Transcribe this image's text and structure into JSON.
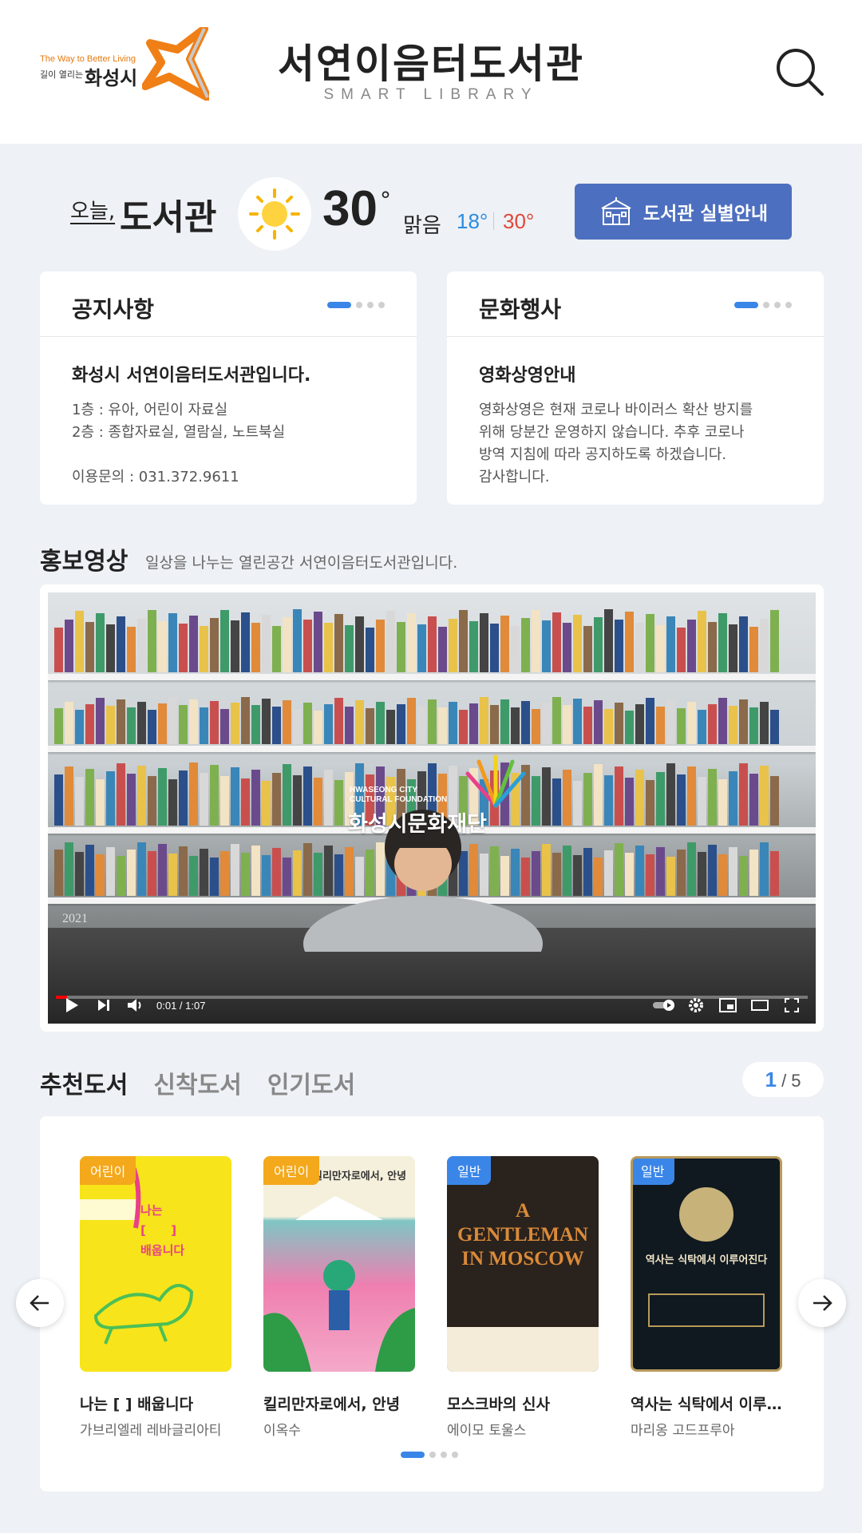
{
  "header": {
    "logo_tagline": "The Way to Better Living",
    "logo_small": "길이 열리는",
    "logo_city": "화성시",
    "title": "서연이음터도서관",
    "subtitle": "SMART LIBRARY",
    "search_icon": "search-icon"
  },
  "weather": {
    "today_label": "오늘,",
    "place_label": "도서관",
    "icon": "sun-icon",
    "temperature": "30",
    "degree": "°",
    "condition": "맑음",
    "low": "18°",
    "high": "30°",
    "guide_button": "도서관 실별안내"
  },
  "notice": {
    "title": "공지사항",
    "heading": "화성시 서연이음터도서관입니다.",
    "line1": "1층 : 유아, 어린이 자료실",
    "line2": "2층 : 종합자료실, 열람실, 노트북실",
    "contact": "이용문의 : 031.372.9611"
  },
  "event": {
    "title": "문화행사",
    "heading": "영화상영안내",
    "line1": "영화상영은 현재 코로나 바이러스 확산 방지를",
    "line2": "위해 당분간 운영하지 않습니다. 추후 코로나",
    "line3": "방역 지침에 따라 공지하도록 하겠습니다.",
    "line4": "감사합니다."
  },
  "promo": {
    "title": "홍보영상",
    "description": "일상을 나누는 열린공간 서연이음터도서관입니다.",
    "watermark_en1": "HWASEONG CITY",
    "watermark_en2": "CULTURAL FOUNDATION",
    "watermark_ko": "화성시문화재단",
    "calendar_text": "2021",
    "time": "0:01 / 1:07",
    "progress": 0.015
  },
  "books": {
    "tabs": [
      "추천도서",
      "신착도서",
      "인기도서"
    ],
    "page_current": "1",
    "page_total": "/ 5",
    "items": [
      {
        "badge": "어린이",
        "title": "나는 [ ] 배웁니다",
        "author": "가브리엘레 레바글리아티",
        "cover_text": "나는\n[      ]\n배웁니다"
      },
      {
        "badge": "어린이",
        "title": "킬리만자로에서, 안녕",
        "author": "이옥수",
        "cover_text": "킬리만자로에서, 안녕"
      },
      {
        "badge": "일반",
        "title": "모스크바의 신사",
        "author": "에이모 토울스",
        "cover_text": "A GENTLEMAN IN MOSCOW"
      },
      {
        "badge": "일반",
        "title": "역사는 식탁에서 이루...",
        "author": "마리옹 고드프루아",
        "cover_text": "역사는 식탁에서 이루어진다"
      }
    ]
  },
  "colors": {
    "accent": "#3a86e8",
    "button": "#4d6fbf",
    "kid_badge": "#f4a81b",
    "low_temp": "#2a8ce0",
    "high_temp": "#e0473a"
  }
}
